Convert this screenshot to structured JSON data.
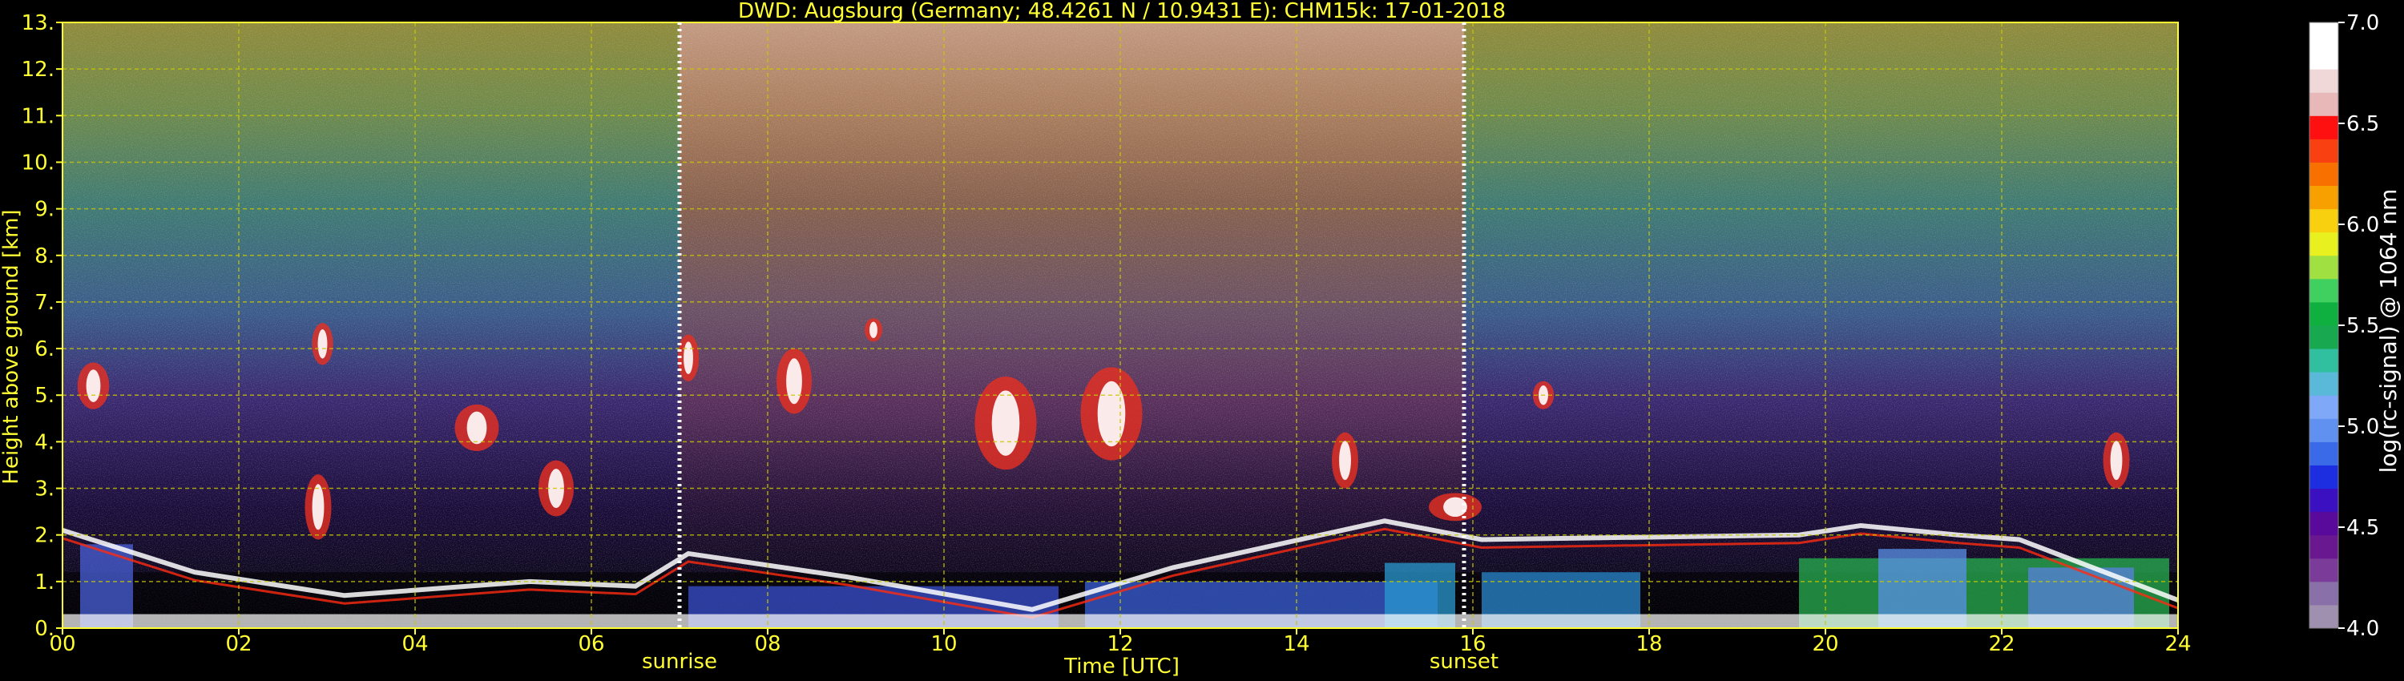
{
  "chart_data": {
    "type": "heatmap",
    "title": "DWD: Augsburg (Germany; 48.4261 N / 10.9431 E):    CHM15k: 17-01-2018",
    "xlabel": "Time [UTC]",
    "ylabel": "Height above ground [km]",
    "xlim": [
      0,
      24
    ],
    "ylim": [
      0,
      13
    ],
    "x_ticks": [
      0,
      2,
      4,
      6,
      8,
      10,
      12,
      14,
      16,
      18,
      20,
      22,
      24
    ],
    "x_tick_labels": [
      "00",
      "02",
      "04",
      "06",
      "08",
      "10",
      "12",
      "14",
      "16",
      "18",
      "20",
      "22",
      "24"
    ],
    "y_ticks": [
      0,
      1,
      2,
      3,
      4,
      5,
      6,
      7,
      8,
      9,
      10,
      11,
      12,
      13
    ],
    "y_tick_labels": [
      "0.",
      "1.",
      "2.",
      "3.",
      "4.",
      "5.",
      "6.",
      "7.",
      "8.",
      "9.",
      "10.",
      "11.",
      "12.",
      "13."
    ],
    "grid": true,
    "markers": [
      {
        "label": "sunrise",
        "time": 7.0
      },
      {
        "label": "sunset",
        "time": 15.9
      }
    ],
    "colorbar": {
      "label": "log(rc-signal) @ 1064 nm",
      "range": [
        4.0,
        7.0
      ],
      "ticks": [
        4.0,
        4.5,
        5.0,
        5.5,
        6.0,
        6.5,
        7.0
      ],
      "tick_labels": [
        "4.0",
        "4.5",
        "5.0",
        "5.5",
        "6.0",
        "6.5",
        "7.0"
      ],
      "colors": [
        "#a090b0",
        "#8a70a8",
        "#7a3c98",
        "#6a1890",
        "#5a0a9a",
        "#3a10c0",
        "#1d2ee0",
        "#3a6ae8",
        "#6090f0",
        "#80a8f8",
        "#5ab8d8",
        "#30c0a0",
        "#18a850",
        "#10b040",
        "#40d060",
        "#a0e040",
        "#e8f020",
        "#f8d010",
        "#f8a000",
        "#f87000",
        "#f84010",
        "#ff1010",
        "#e8b8b8",
        "#f0d8d8",
        "#ffffff",
        "#ffffff"
      ]
    },
    "colors": {
      "background": "#000000",
      "text": "#ffff33",
      "grid": "#c8c800",
      "marker_line": "#ffffff"
    }
  }
}
